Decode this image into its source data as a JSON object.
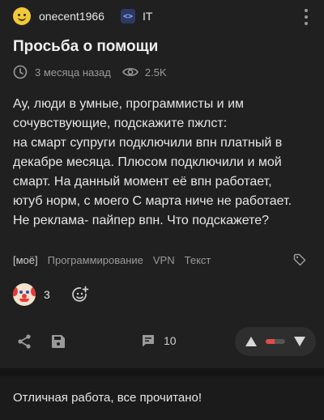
{
  "post": {
    "author": "onecent1966",
    "community_icon_text": "<>",
    "community": "IT",
    "title": "Просьба о помощи",
    "time_ago": "3 месяца назад",
    "views": "2.5K",
    "body_lines": [
      "Ау, люди в умные, программисты и им",
      "сочувствующие, подскажите пжлст:",
      "на смарт супруги подключили впн платный в",
      "декабре месяца. Плюсом подключили и мой",
      "смарт. На данный момент её впн работает,",
      "ютуб норм, с моего С марта ниче не работает.",
      "Не реклама- пайпер впн. Что подскажете?"
    ],
    "tags": [
      "[моё]",
      "Программирование",
      "VPN",
      "Текст"
    ],
    "reaction_count": "3",
    "comment_count": "10",
    "rating_red_fraction": 0.45
  },
  "footer": {
    "message": "Отличная работа, все прочитано!"
  },
  "colors": {
    "background": "#202020",
    "muted_text": "#9a9a9a",
    "downvote_red": "#e24b4b"
  },
  "icons": [
    "user-avatar-icon",
    "code-brackets-icon",
    "more-vertical-icon",
    "clock-icon",
    "eye-icon",
    "tag-icon",
    "clown-reaction-icon",
    "add-reaction-icon",
    "share-icon",
    "save-icon",
    "comment-icon",
    "upvote-icon",
    "downvote-icon"
  ]
}
